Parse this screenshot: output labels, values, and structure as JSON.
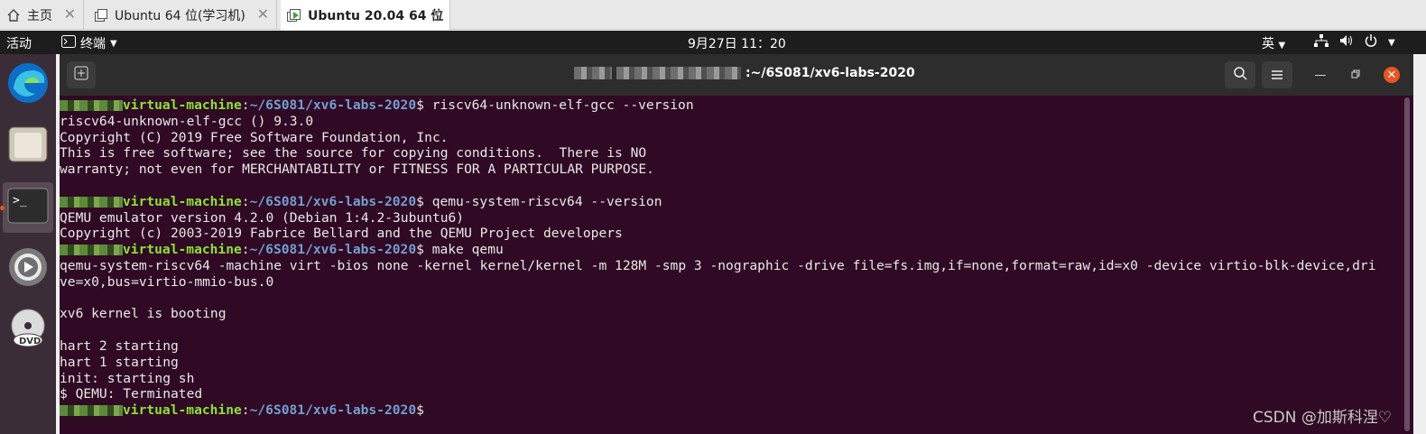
{
  "vm_tabs": [
    {
      "label": "主页",
      "icon": "home-icon"
    },
    {
      "label": "Ubuntu 64 位(学习机)",
      "icon": "vm-icon"
    },
    {
      "label": "Ubuntu 20.04 64 位",
      "icon": "vm-running-icon"
    }
  ],
  "topbar": {
    "activities": "活动",
    "app_menu": "终端",
    "clock": "9月27日  11：20",
    "ime": "英"
  },
  "dock": [
    "edge-icon",
    "files-icon",
    "terminal-icon",
    "software-updater-icon",
    "dvd-icon"
  ],
  "terminal": {
    "title_path": ":~/6S081/xv6-labs-2020",
    "prompt_host": "virtual-machine",
    "prompt_path": "~/6S081/xv6-labs-2020",
    "lines": [
      {
        "type": "prompt",
        "cmd": "riscv64-unknown-elf-gcc --version"
      },
      {
        "type": "out",
        "text": "riscv64-unknown-elf-gcc () 9.3.0"
      },
      {
        "type": "out",
        "text": "Copyright (C) 2019 Free Software Foundation, Inc."
      },
      {
        "type": "out",
        "text": "This is free software; see the source for copying conditions.  There is NO"
      },
      {
        "type": "out",
        "text": "warranty; not even for MERCHANTABILITY or FITNESS FOR A PARTICULAR PURPOSE."
      },
      {
        "type": "out",
        "text": ""
      },
      {
        "type": "prompt",
        "cmd": "qemu-system-riscv64 --version"
      },
      {
        "type": "out",
        "text": "QEMU emulator version 4.2.0 (Debian 1:4.2-3ubuntu6)"
      },
      {
        "type": "out",
        "text": "Copyright (c) 2003-2019 Fabrice Bellard and the QEMU Project developers"
      },
      {
        "type": "prompt",
        "cmd": "make qemu"
      },
      {
        "type": "out",
        "text": "qemu-system-riscv64 -machine virt -bios none -kernel kernel/kernel -m 128M -smp 3 -nographic -drive file=fs.img,if=none,format=raw,id=x0 -device virtio-blk-device,dri"
      },
      {
        "type": "out",
        "text": "ve=x0,bus=virtio-mmio-bus.0"
      },
      {
        "type": "out",
        "text": ""
      },
      {
        "type": "out",
        "text": "xv6 kernel is booting"
      },
      {
        "type": "out",
        "text": ""
      },
      {
        "type": "out",
        "text": "hart 2 starting"
      },
      {
        "type": "out",
        "text": "hart 1 starting"
      },
      {
        "type": "out",
        "text": "init: starting sh"
      },
      {
        "type": "out",
        "text": "$ QEMU: Terminated"
      },
      {
        "type": "prompt",
        "cmd": ""
      }
    ]
  },
  "watermark": "CSDN @加斯科涅♡",
  "colors": {
    "terminal_bg": "#300a24",
    "host": "#8ae234",
    "path": "#729fcf",
    "accent": "#e95420"
  }
}
